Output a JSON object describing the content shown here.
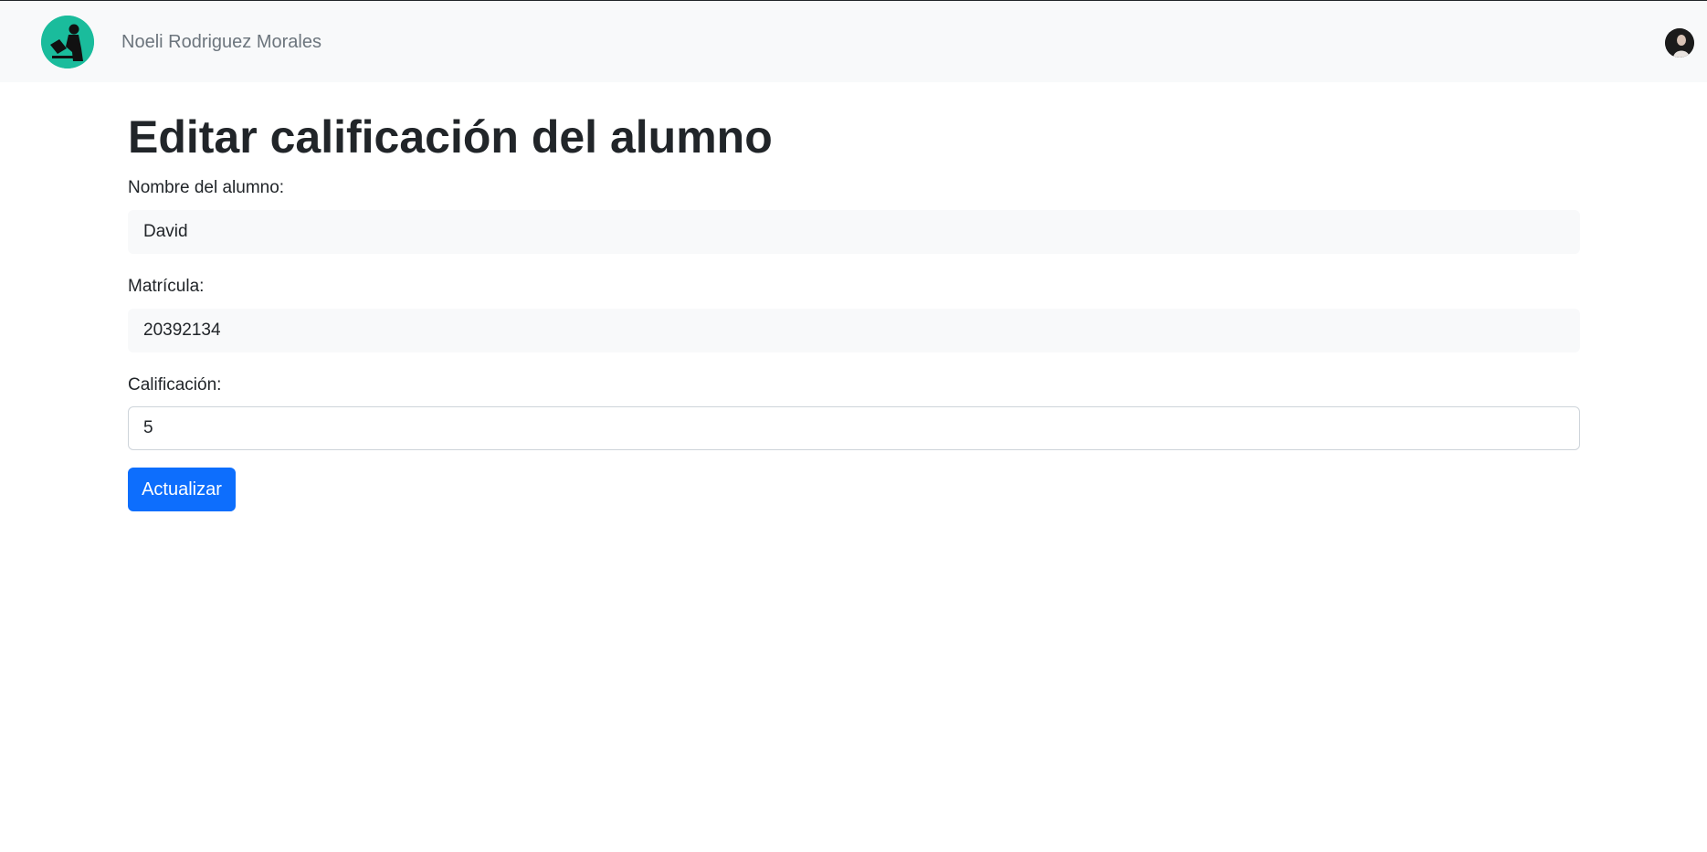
{
  "navbar": {
    "brand_name": "Noeli Rodriguez Morales",
    "logo_icon": "person-reading-book-icon",
    "avatar_icon": "user-avatar",
    "background_color": "#f8f9fa",
    "logo_color": "#1abc9c"
  },
  "main": {
    "title": "Editar calificación del alumno",
    "fields": {
      "student_name": {
        "label": "Nombre del alumno:",
        "value": "David",
        "readonly": true
      },
      "enrollment": {
        "label": "Matrícula:",
        "value": "20392134",
        "readonly": true
      },
      "grade": {
        "label": "Calificación:",
        "value": "5",
        "readonly": false
      }
    },
    "submit_label": "Actualizar",
    "accent_color": "#0d6efd"
  }
}
